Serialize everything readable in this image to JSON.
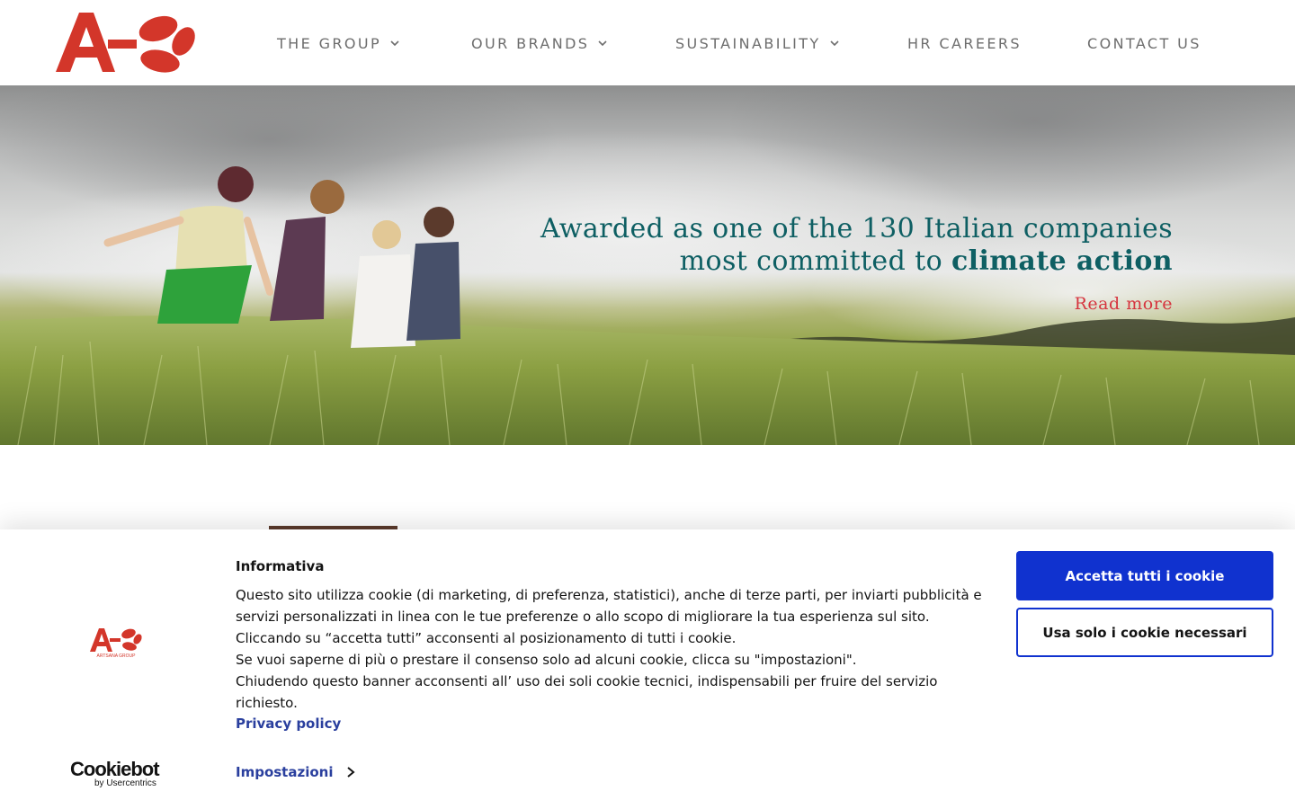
{
  "header": {
    "logo_icon": "artsana-a-logo-icon",
    "nav": [
      {
        "label": "THE GROUP",
        "has_dropdown": true
      },
      {
        "label": "OUR BRANDS",
        "has_dropdown": true
      },
      {
        "label": "SUSTAINABILITY",
        "has_dropdown": true
      },
      {
        "label": "HR CAREERS",
        "has_dropdown": false
      },
      {
        "label": "CONTACT US",
        "has_dropdown": false
      }
    ]
  },
  "hero": {
    "headline_line1": "Awarded as one of the 130 Italian companies",
    "headline_line2_plain": "most committed to ",
    "headline_line2_strong": "climate action",
    "read_more": "Read more",
    "image": "children-walking-in-grass-field"
  },
  "cookie_banner": {
    "brand_logo_icon": "artsana-group-logo-icon",
    "brand_logo_caption": "ARTSANA GROUP",
    "provider_name": "Cookiebot",
    "provider_byline": "by Usercentrics",
    "title": "Informativa",
    "lines": [
      "Questo sito utilizza cookie (di marketing, di preferenza, statistici), anche di terze parti, per inviarti pubblicità e",
      "servizi personalizzati in linea con le tue preferenze o allo scopo di migliorare la tua esperienza sul sito.",
      "Cliccando su “accetta tutti” acconsenti al posizionamento di tutti i cookie.",
      "Se vuoi saperne di più o prestare il consenso solo ad alcuni cookie, clicca su \"impostazioni\".",
      "Chiudendo questo banner acconsenti all’ uso dei soli cookie tecnici, indispensabili per fruire del servizio",
      "richiesto."
    ],
    "privacy_link": "Privacy policy",
    "settings_link": "Impostazioni",
    "accept_all": "Accetta tutti i cookie",
    "necessary_only": "Usa solo i cookie necessari",
    "colors": {
      "primary": "#1032cf",
      "link": "#2a3f9e"
    }
  },
  "colors": {
    "brand_red": "#d3362a",
    "hero_text": "#0e5f63",
    "read_more": "#d6343e",
    "nav_text": "#6d6d6d"
  }
}
